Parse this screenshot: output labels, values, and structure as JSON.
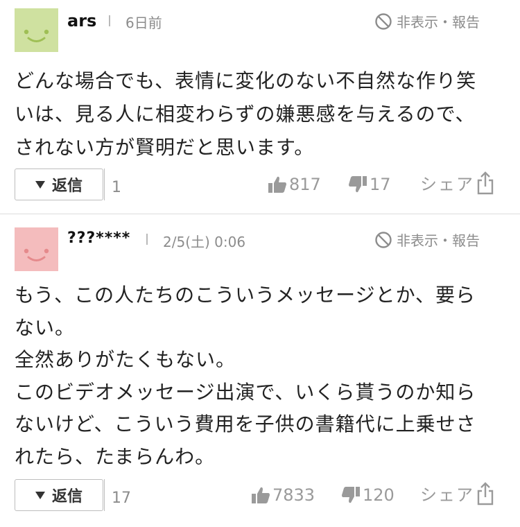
{
  "colors": {
    "avatar1": "#cfe1a0",
    "avatar2": "#f4bcbd",
    "muted": "#8c8c8c",
    "text": "#222222"
  },
  "comments": [
    {
      "avatar_icon": "smile-face-icon",
      "user": "ars",
      "time": "6日前",
      "hide_report": "非表示・報告",
      "lines": [
        "どんな場合でも、表情に変化のない不自然な作り笑",
        "いは、見る人に相変わらずの嫌悪感を与えるので、",
        "されない方が賢明だと思います。"
      ],
      "reply_label": "返信",
      "reply_count": "1",
      "likes": "817",
      "dislikes": "17",
      "share_label": "シェア"
    },
    {
      "avatar_icon": "smile-face-icon",
      "user": "???****",
      "time": "2/5(土) 0:06",
      "hide_report": "非表示・報告",
      "lines": [
        "もう、この人たちのこういうメッセージとか、要ら",
        "ない。",
        "全然ありがたくもない。",
        "このビデオメッセージ出演で、いくら貰うのか知ら",
        "ないけど、こういう費用を子供の書籍代に上乗せさ",
        "れたら、たまらんわ。"
      ],
      "reply_label": "返信",
      "reply_count": "17",
      "likes": "7833",
      "dislikes": "120",
      "share_label": "シェア"
    }
  ]
}
